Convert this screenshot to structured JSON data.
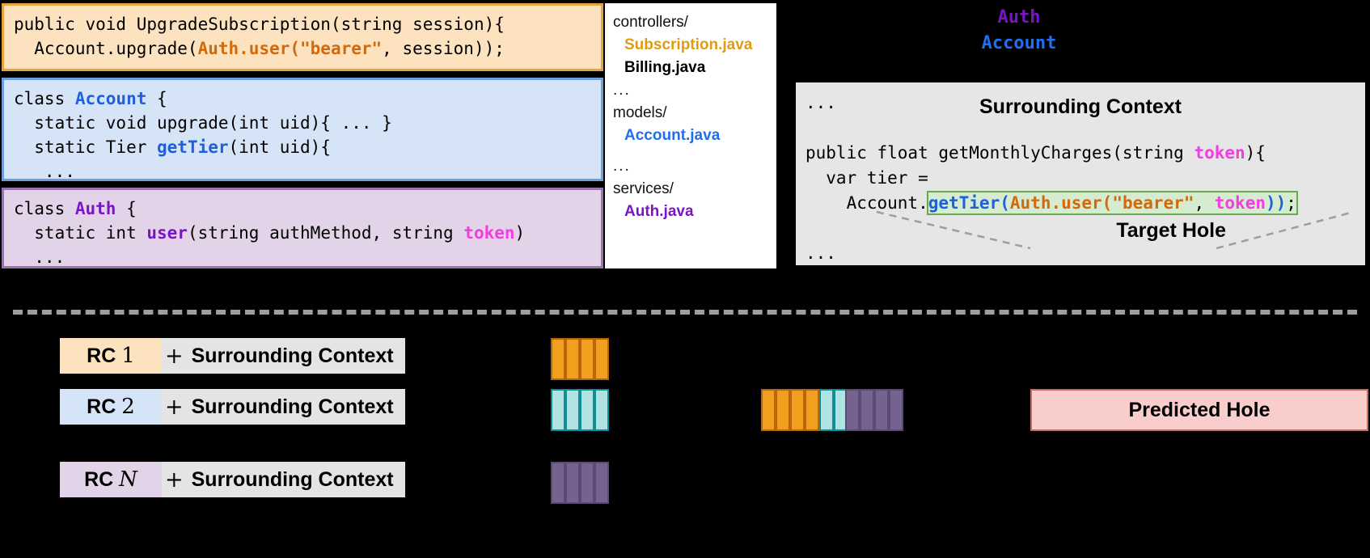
{
  "snippets": [
    {
      "id": "rc1",
      "lines": [
        [
          {
            "t": "public void UpgradeSubscription(string session){",
            "c": "plain"
          }
        ],
        [
          {
            "t": "  Account.upgrade(",
            "c": "plain"
          },
          {
            "t": "Auth.user(\"bearer\"",
            "c": "orange"
          },
          {
            "t": ", session));",
            "c": "plain"
          }
        ]
      ]
    },
    {
      "id": "rc2",
      "lines": [
        [
          {
            "t": "class ",
            "c": "plain"
          },
          {
            "t": "Account",
            "c": "blue"
          },
          {
            "t": " {",
            "c": "plain"
          }
        ],
        [
          {
            "t": "  static void upgrade(int uid){ ... }",
            "c": "plain"
          }
        ],
        [
          {
            "t": "  static Tier ",
            "c": "plain"
          },
          {
            "t": "getTier",
            "c": "blue"
          },
          {
            "t": "(int uid){",
            "c": "plain"
          }
        ],
        [
          {
            "t": "   ...",
            "c": "plain"
          }
        ]
      ]
    },
    {
      "id": "rcn",
      "lines": [
        [
          {
            "t": "class ",
            "c": "plain"
          },
          {
            "t": "Auth",
            "c": "purple"
          },
          {
            "t": " {",
            "c": "plain"
          }
        ],
        [
          {
            "t": "  static int ",
            "c": "plain"
          },
          {
            "t": "user",
            "c": "purple"
          },
          {
            "t": "(string authMethod, string ",
            "c": "plain"
          },
          {
            "t": "token",
            "c": "pink"
          },
          {
            "t": ")",
            "c": "plain"
          }
        ],
        [
          {
            "t": "  ...",
            "c": "plain"
          }
        ]
      ]
    }
  ],
  "filetree": {
    "entries": [
      {
        "kind": "dir",
        "label": "controllers/"
      },
      {
        "kind": "file",
        "label": "Subscription.java",
        "color": "orange"
      },
      {
        "kind": "file",
        "label": "Billing.java",
        "color": "black"
      },
      {
        "kind": "dots",
        "label": "..."
      },
      {
        "kind": "dir",
        "label": "models/"
      },
      {
        "kind": "file",
        "label": "Account.java",
        "color": "blue"
      },
      {
        "kind": "gap",
        "label": ""
      },
      {
        "kind": "dots",
        "label": "..."
      },
      {
        "kind": "dir",
        "label": "services/"
      },
      {
        "kind": "file",
        "label": "Auth.java",
        "color": "purple"
      }
    ]
  },
  "context_labels": [
    {
      "text": "Auth",
      "color": "purple"
    },
    {
      "text": "Account",
      "color": "blue"
    }
  ],
  "context": {
    "title": "Surrounding Context",
    "top_ellipsis": "...",
    "bottom_ellipsis": "...",
    "target_hole_label": "Target Hole",
    "code_lines": [
      [
        {
          "t": "public float getMonthlyCharges(string ",
          "c": "plain"
        },
        {
          "t": "token",
          "c": "pink"
        },
        {
          "t": "){",
          "c": "plain"
        }
      ],
      [
        {
          "t": "  var tier =",
          "c": "plain"
        }
      ],
      [
        {
          "t": "    Account.",
          "c": "plain"
        },
        {
          "t": "getTier",
          "c": "blue",
          "hole": true
        },
        {
          "t": "(",
          "c": "blue",
          "hole": true
        },
        {
          "t": "Auth.user(\"bearer\"",
          "c": "orange",
          "hole": true
        },
        {
          "t": ", ",
          "c": "plain",
          "hole": true
        },
        {
          "t": "token",
          "c": "pink",
          "hole": true
        },
        {
          "t": "))",
          "c": "blue",
          "hole": true
        },
        {
          "t": ";",
          "c": "plain",
          "hole": true
        }
      ]
    ]
  },
  "rc_rows": [
    {
      "tag_prefix": "RC",
      "tag_num": "1",
      "italic": false,
      "plus": "+",
      "context_label": "Surrounding Context",
      "tag_color": "#fde2c0"
    },
    {
      "tag_prefix": "RC",
      "tag_num": "2",
      "italic": false,
      "plus": "+",
      "context_label": "Surrounding Context",
      "tag_color": "#d6e4f7"
    },
    {
      "tag_prefix": "RC",
      "tag_num": "N",
      "italic": true,
      "plus": "+",
      "context_label": "Surrounding Context",
      "tag_color": "#e2d3e8"
    }
  ],
  "token_bars": [
    {
      "id": "bar-rc1",
      "color": "orange",
      "segments": 4
    },
    {
      "id": "bar-rc2",
      "color": "teal",
      "segments": 4
    },
    {
      "id": "bar-rcn",
      "color": "purple",
      "segments": 4
    },
    {
      "id": "bar-mix-o",
      "color": "orange",
      "segments": 4
    },
    {
      "id": "bar-mix-t",
      "color": "teal",
      "segments": 4
    },
    {
      "id": "bar-mix-p",
      "color": "purple",
      "segments": 4
    }
  ],
  "predicted": {
    "label": "Predicted Hole"
  },
  "colors": {
    "orange": "#d2690a",
    "blue": "#1f5fdb",
    "purple": "#7a14c4",
    "pink": "#f23de0",
    "hole_highlight": "#d6ecd0",
    "hole_border": "#6aa84f",
    "predicted_bg": "#f9cdcb",
    "predicted_border": "#c96a63",
    "rc1_bg": "#fde2c0",
    "rc2_bg": "#d6e4f7",
    "rcn_bg": "#e2d3e8",
    "context_bg": "#e6e6e6",
    "separator": "#9e9e9e",
    "background": "#000000"
  }
}
